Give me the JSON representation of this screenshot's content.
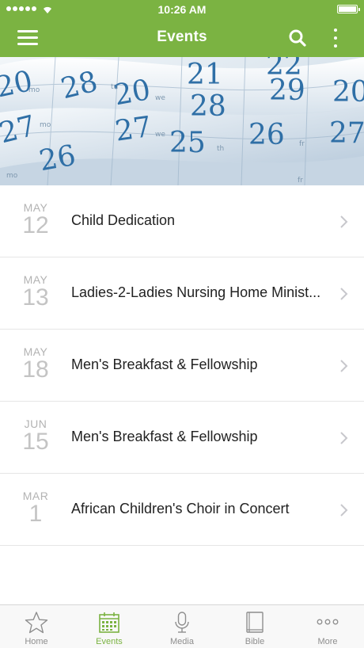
{
  "status_bar": {
    "time": "10:26 AM"
  },
  "nav": {
    "title": "Events"
  },
  "events": [
    {
      "month": "MAY",
      "day": "12",
      "title": "Child Dedication"
    },
    {
      "month": "MAY",
      "day": "13",
      "title": "Ladies-2-Ladies Nursing Home Minist..."
    },
    {
      "month": "MAY",
      "day": "18",
      "title": "Men's Breakfast & Fellowship"
    },
    {
      "month": "JUN",
      "day": "15",
      "title": "Men's Breakfast & Fellowship"
    },
    {
      "month": "MAR",
      "day": "1",
      "title": "African Children's Choir in Concert"
    }
  ],
  "tabs": [
    {
      "label": "Home",
      "icon": "star-icon",
      "active": false
    },
    {
      "label": "Events",
      "icon": "calendar-icon",
      "active": true
    },
    {
      "label": "Media",
      "icon": "microphone-icon",
      "active": false
    },
    {
      "label": "Bible",
      "icon": "book-icon",
      "active": false
    },
    {
      "label": "More",
      "icon": "more-dots-icon",
      "active": false
    }
  ],
  "colors": {
    "brand_green": "#7bb342",
    "banner_numbers": "#2f6fa6"
  }
}
